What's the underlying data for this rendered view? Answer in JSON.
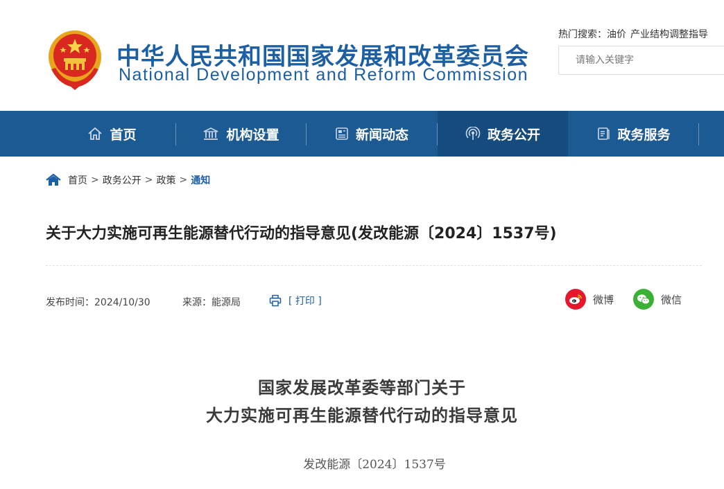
{
  "header": {
    "site_name_cn": "中华人民共和国国家发展和改革委员会",
    "site_name_en": "National Development and Reform Commission",
    "hot_search_label": "热门搜索：",
    "hot_terms": [
      "油价",
      "产业结构调整指导"
    ],
    "search_placeholder": "请输入关键字"
  },
  "nav": {
    "items": [
      {
        "label": "首页",
        "icon": "home-icon"
      },
      {
        "label": "机构设置",
        "icon": "building-icon"
      },
      {
        "label": "新闻动态",
        "icon": "news-icon"
      },
      {
        "label": "政务公开",
        "icon": "broadcast-icon",
        "active": true
      },
      {
        "label": "政务服务",
        "icon": "service-icon"
      }
    ]
  },
  "breadcrumb": {
    "items": [
      "首页",
      "政务公开",
      "政策"
    ],
    "current": "通知",
    "separator": ">"
  },
  "article": {
    "title": "关于大力实施可再生能源替代行动的指导意见(发改能源〔2024〕1537号)",
    "publish_time": "发布时间：2024/10/30",
    "source": "来源：能源局",
    "print_label": "[ 打印 ]",
    "share_weibo": "微博",
    "share_wechat": "微信",
    "heading_line1": "国家发展改革委等部门关于",
    "heading_line2": "大力实施可再生能源替代行动的指导意见",
    "doc_number": "发改能源〔2024〕1537号"
  },
  "colors": {
    "brand_blue": "#1d5fa3",
    "nav_bg": "#1c5a93",
    "nav_active": "#164b7d",
    "weibo_red": "#e6162d",
    "wechat_green": "#3cb034"
  }
}
